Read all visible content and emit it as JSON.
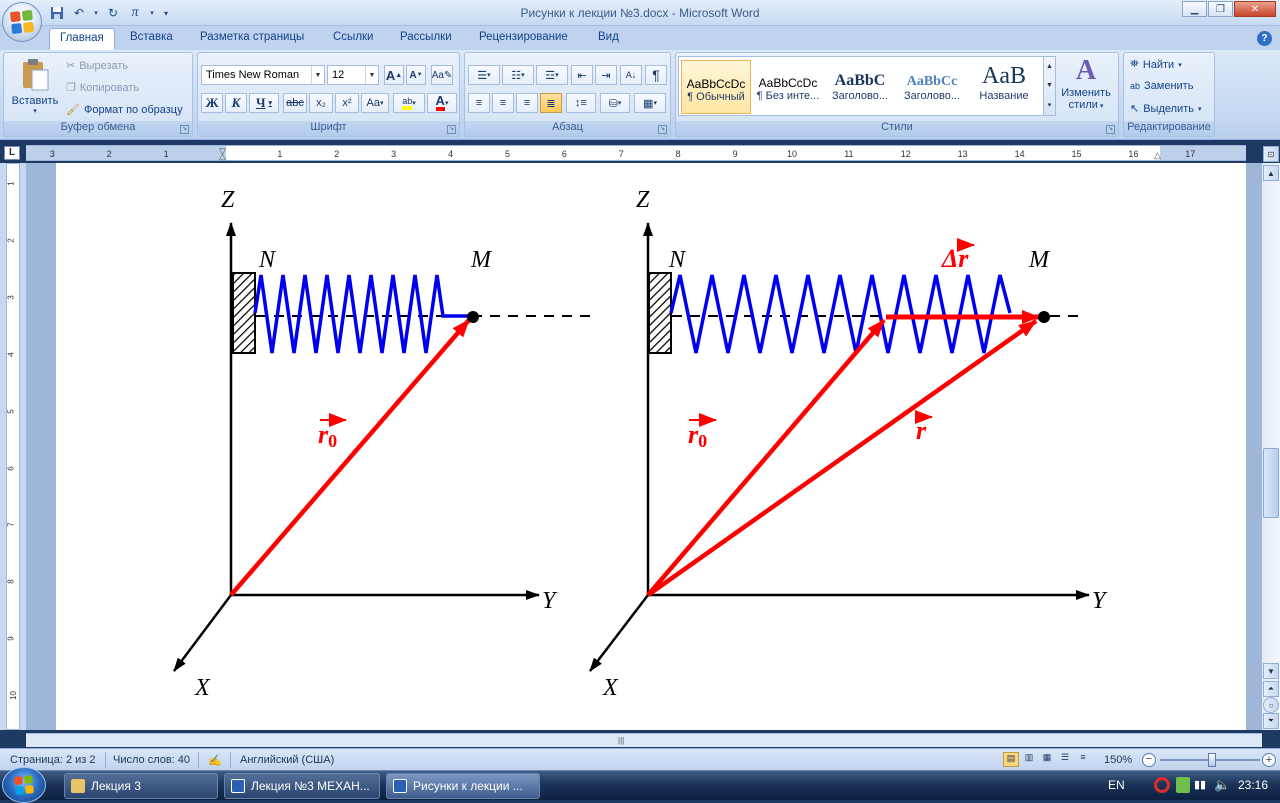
{
  "window": {
    "title": "Рисунки к лекции №3.docx - Microsoft Word",
    "controls": {
      "minimize": "▁",
      "restore": "❐",
      "close": "✕"
    }
  },
  "quick_access": {
    "items": [
      "save-icon",
      "undo-icon",
      "redo-icon",
      "pi-icon"
    ],
    "pi_label": "π"
  },
  "tabs": [
    "Главная",
    "Вставка",
    "Разметка страницы",
    "Ссылки",
    "Рассылки",
    "Рецензирование",
    "Вид"
  ],
  "ribbon": {
    "clipboard": {
      "label": "Буфер обмена",
      "paste": "Вставить",
      "cut": "Вырезать",
      "copy": "Копировать",
      "format_painter": "Формат по образцу"
    },
    "font": {
      "label": "Шрифт",
      "font_name": "Times New Roman",
      "font_size": "12",
      "bold": "Ж",
      "italic": "К",
      "underline": "Ч",
      "strike": "abc",
      "subscript": "x₂",
      "superscript": "x²",
      "change_case": "Aa",
      "grow": "A",
      "shrink": "A",
      "highlight": "ab",
      "font_color": "A"
    },
    "paragraph": {
      "label": "Абзац",
      "pilcrow": "¶"
    },
    "styles": {
      "label": "Стили",
      "items": [
        {
          "sample": "AaBbCcDc",
          "name": "¶ Обычный"
        },
        {
          "sample": "AaBbCcDc",
          "name": "¶ Без инте..."
        },
        {
          "sample": "AaBbC",
          "name": "Заголово..."
        },
        {
          "sample": "AaBbCc",
          "name": "Заголово..."
        },
        {
          "sample": "AaB",
          "name": "Название"
        }
      ],
      "change_styles_line1": "Изменить",
      "change_styles_line2": "стили"
    },
    "editing": {
      "label": "Редактирование",
      "find": "Найти",
      "replace": "Заменить",
      "select": "Выделить"
    }
  },
  "ruler": {
    "horizontal": [
      "3",
      "2",
      "1",
      "1",
      "2",
      "3",
      "4",
      "5",
      "6",
      "7",
      "8",
      "9",
      "10",
      "11",
      "12",
      "13",
      "14",
      "15",
      "16",
      "17"
    ],
    "vertical": [
      "1",
      "2",
      "3",
      "4",
      "5",
      "6",
      "7",
      "8",
      "9",
      "10"
    ],
    "corner": "L"
  },
  "figure": {
    "axis_z": "Z",
    "axis_y": "Y",
    "axis_x": "X",
    "point_n": "N",
    "point_m": "M",
    "vec_r0": "r",
    "vec_r0_sub": "0",
    "vec_r": "r",
    "vec_dr": "Δr",
    "colors": {
      "spring": "#0000ee",
      "vector": "#ff0000",
      "axis": "#000000"
    }
  },
  "status": {
    "page": "Страница: 2 из 2",
    "words": "Число слов: 40",
    "language": "Английский (США)",
    "zoom": "150%"
  },
  "taskbar": {
    "items": [
      "Лекция 3",
      "Лекция №3 МЕХАН...",
      "Рисунки к лекции ..."
    ],
    "lang": "EN",
    "time": "23:16"
  }
}
